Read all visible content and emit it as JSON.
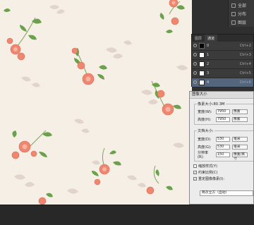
{
  "toolbar": {
    "items": [
      {
        "label": "全部",
        "icon": "align-icon"
      },
      {
        "label": "分布",
        "icon": "distribute-icon"
      },
      {
        "label": "图层",
        "icon": "layers-icon"
      }
    ]
  },
  "layers_panel": {
    "tabs": [
      "图层",
      "通道"
    ],
    "active_tab": "通道",
    "rows": [
      {
        "name": "0",
        "shortcut": "Ctrl+2",
        "thumb": "black",
        "selected": false
      },
      {
        "name": "1",
        "shortcut": "Ctrl+3",
        "thumb": "white",
        "selected": false
      },
      {
        "name": "2",
        "shortcut": "Ctrl+4",
        "thumb": "white",
        "selected": false
      },
      {
        "name": "3",
        "shortcut": "Ctrl+5",
        "thumb": "white",
        "selected": false
      },
      {
        "name": "4",
        "shortcut": "Ctrl+6",
        "thumb": "white",
        "selected": true
      }
    ]
  },
  "dialog": {
    "title": "图像大小",
    "pixel_group": {
      "legend": "像素大小:80.3M",
      "width_label": "宽度(W):",
      "width_value": "7950",
      "width_unit": "像素",
      "height_label": "高度(H):",
      "height_value": "7950",
      "height_unit": "像素"
    },
    "doc_group": {
      "legend": "文档大小:",
      "width_label": "宽度(D):",
      "width_value": "530",
      "width_unit": "毫米",
      "height_label": "高度(G):",
      "height_value": "530",
      "height_unit": "毫米",
      "res_label": "分辨率(R):",
      "res_value": "150",
      "res_unit": "像素/英寸"
    },
    "checks": [
      {
        "label": "缩放样式(Y)",
        "checked": false
      },
      {
        "label": "约束比例(C)",
        "checked": true
      },
      {
        "label": "重定图像像素(I):",
        "checked": true
      }
    ],
    "resample_method": "两次立方（自动）"
  },
  "colors": {
    "canvas_bg": "#f5efe6",
    "flower": "#ee8670",
    "leaf": "#6ba04c",
    "ghost_leaf": "#d8c8c4",
    "selected_layer": "#53667d"
  }
}
